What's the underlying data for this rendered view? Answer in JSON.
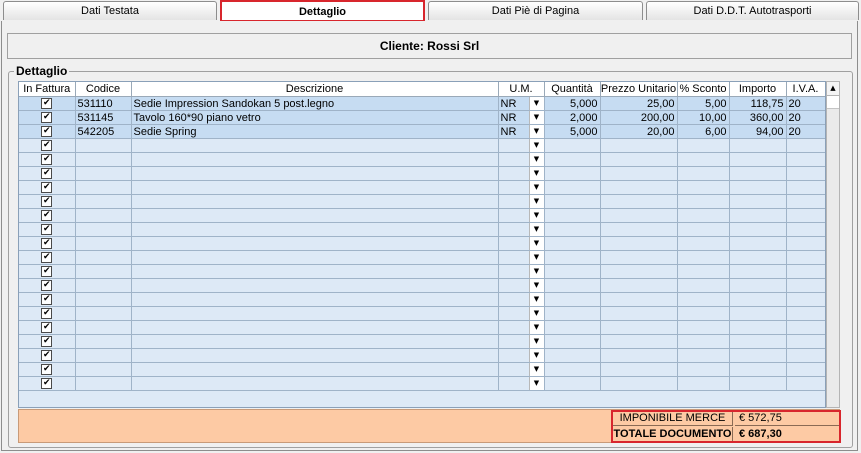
{
  "tabs": [
    {
      "label": "Dati Testata",
      "active": false
    },
    {
      "label": "Dettaglio",
      "active": true
    },
    {
      "label": "Dati Piè di Pagina",
      "active": false
    },
    {
      "label": "Dati D.D.T. Autotrasporti",
      "active": false
    }
  ],
  "client": {
    "label": "Cliente: Rossi Srl"
  },
  "section": {
    "legend": "Dettaglio"
  },
  "grid": {
    "headers": [
      "In Fattura",
      "Codice",
      "Descrizione",
      "U.M.",
      "Quantità",
      "Prezzo Unitario",
      "% Sconto",
      "Importo",
      "I.V.A."
    ],
    "rows": [
      {
        "checked": true,
        "codice": "531110",
        "descrizione": "Sedie Impression Sandokan 5 post.legno",
        "um": "NR",
        "quantita": "5,000",
        "prezzo": "25,00",
        "sconto": "5,00",
        "importo": "118,75",
        "iva": "20"
      },
      {
        "checked": true,
        "codice": "531145",
        "descrizione": "Tavolo 160*90 piano vetro",
        "um": "NR",
        "quantita": "2,000",
        "prezzo": "200,00",
        "sconto": "10,00",
        "importo": "360,00",
        "iva": "20"
      },
      {
        "checked": true,
        "codice": "542205",
        "descrizione": "Sedie Spring",
        "um": "NR",
        "quantita": "5,000",
        "prezzo": "20,00",
        "sconto": "6,00",
        "importo": "94,00",
        "iva": "20"
      }
    ],
    "empty_rows": 18,
    "check_glyph": "✔",
    "dropdown_icon": "chevron-down-icon"
  },
  "totals": {
    "imponibile_label": "IMPONIBILE MERCE",
    "imponibile_value": "€ 572,75",
    "totale_label": "TOTALE DOCUMENTO",
    "totale_value": "€ 687,30"
  },
  "colors": {
    "highlight": "#d8262d",
    "row_filled": "#c6dcf2",
    "row_empty": "#dde9f6",
    "totals_bg": "#fdcaa4"
  }
}
